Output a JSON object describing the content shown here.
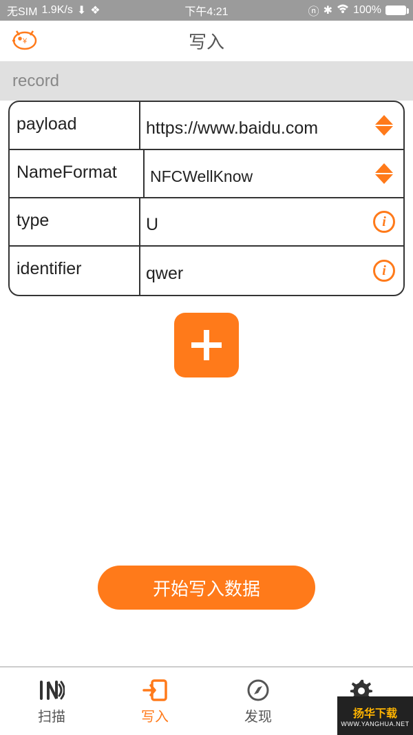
{
  "status": {
    "sim": "无SIM",
    "speed": "1.9K/s",
    "time": "下午4:21",
    "battery": "100%"
  },
  "nav": {
    "title": "写入"
  },
  "section": {
    "header": "record"
  },
  "rows": [
    {
      "label": "payload",
      "value": "https://www.baidu.com",
      "control": "sort"
    },
    {
      "label": "NameFormat",
      "value": "NFCWellKnow",
      "control": "sort"
    },
    {
      "label": "type",
      "value": "U",
      "control": "info"
    },
    {
      "label": "identifier",
      "value": "qwer",
      "control": "info"
    }
  ],
  "buttons": {
    "add": "+",
    "primary": "开始写入数据"
  },
  "tabs": [
    {
      "label": "扫描"
    },
    {
      "label": "写入"
    },
    {
      "label": "发现"
    },
    {
      "label": "设置"
    }
  ],
  "watermark": {
    "top": "扬华下载",
    "bot": "WWW.YANGHUA.NET"
  }
}
